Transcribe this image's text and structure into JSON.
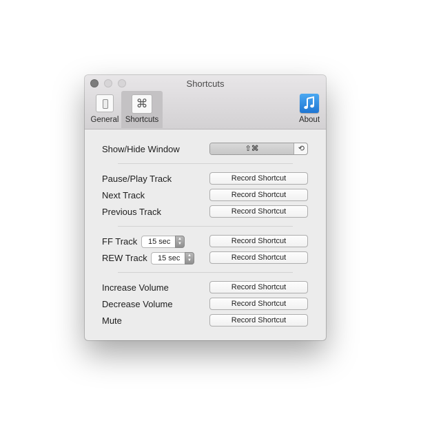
{
  "window": {
    "title": "Shortcuts"
  },
  "tabs": {
    "general": {
      "label": "General",
      "icon": "switch-icon"
    },
    "shortcuts": {
      "label": "Shortcuts",
      "icon": "command-icon",
      "glyph": "⌘",
      "selected": true
    },
    "about": {
      "label": "About",
      "icon": "music-note-icon",
      "accent": "#2a86e0"
    }
  },
  "show_hide": {
    "label": "Show/Hide Window",
    "keys": "⇧⌘",
    "reset_glyph": "⟲"
  },
  "playback": [
    {
      "label": "Pause/Play Track",
      "button": "Record Shortcut"
    },
    {
      "label": "Next Track",
      "button": "Record Shortcut"
    },
    {
      "label": "Previous Track",
      "button": "Record Shortcut"
    }
  ],
  "seek": [
    {
      "label": "FF Track",
      "value": "15 sec",
      "button": "Record Shortcut"
    },
    {
      "label": "REW Track",
      "value": "15 sec",
      "button": "Record Shortcut"
    }
  ],
  "volume": [
    {
      "label": "Increase Volume",
      "button": "Record Shortcut"
    },
    {
      "label": "Decrease Volume",
      "button": "Record Shortcut"
    },
    {
      "label": "Mute",
      "button": "Record Shortcut"
    }
  ],
  "stepper_glyphs": {
    "up": "▲",
    "down": "▼"
  }
}
